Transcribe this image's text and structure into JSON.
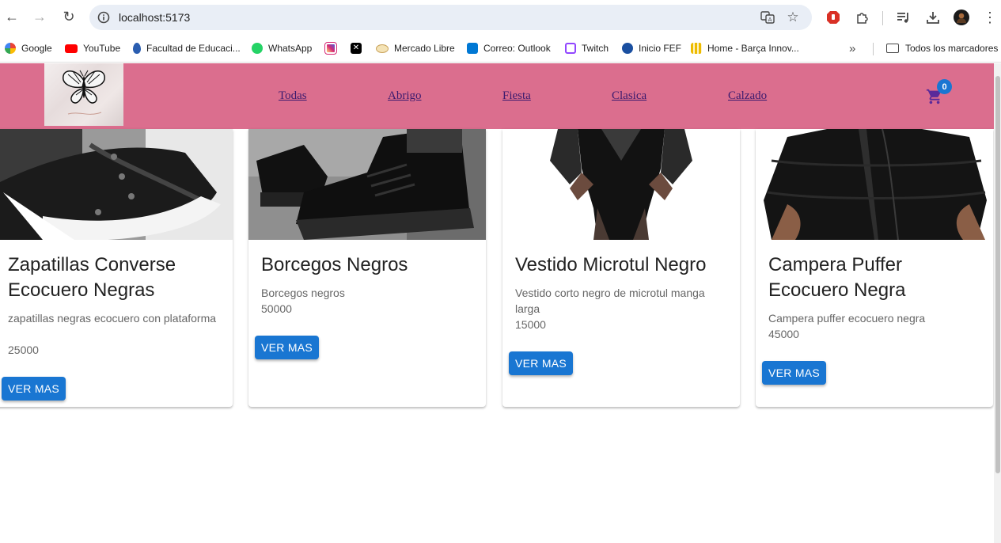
{
  "browser": {
    "url": "localhost:5173",
    "bookmarks": [
      {
        "label": "Google",
        "color": "#4285f4"
      },
      {
        "label": "YouTube",
        "color": "#ff0000"
      },
      {
        "label": "Facultad de Educaci...",
        "color": "#2a5db0"
      },
      {
        "label": "WhatsApp",
        "color": "#25d366"
      },
      {
        "label": "",
        "color": "#d62976"
      },
      {
        "label": "",
        "color": "#000000"
      },
      {
        "label": "Mercado Libre",
        "color": "#ffe600"
      },
      {
        "label": "Correo: Outlook",
        "color": "#0078d4"
      },
      {
        "label": "Twitch",
        "color": "#9146ff"
      },
      {
        "label": "Inicio FEF",
        "color": "#1a4fa0"
      },
      {
        "label": "Home - Barça Innov...",
        "color": "#edbb00"
      }
    ],
    "all_bookmarks_label": "Todos los marcadores"
  },
  "header": {
    "nav": [
      "Todas",
      "Abrigo",
      "Fiesta",
      "Clasica",
      "Calzado"
    ],
    "cart_count": "0",
    "brand_color": "#db6e8e"
  },
  "products": [
    {
      "title": "Zapatillas Converse Ecocuero Negras",
      "description": "zapatillas negras ecocuero con plataforma",
      "price": "25000",
      "button": "VER MAS"
    },
    {
      "title": "Borcegos Negros",
      "description": "Borcegos negros",
      "price": "50000",
      "button": "VER MAS"
    },
    {
      "title": "Vestido Microtul Negro",
      "description": "Vestido corto negro de microtul manga larga",
      "price": "15000",
      "button": "VER MAS"
    },
    {
      "title": "Campera Puffer Ecocuero Negra",
      "description": "Campera puffer ecocuero negra",
      "price": "45000",
      "button": "VER MAS"
    }
  ]
}
